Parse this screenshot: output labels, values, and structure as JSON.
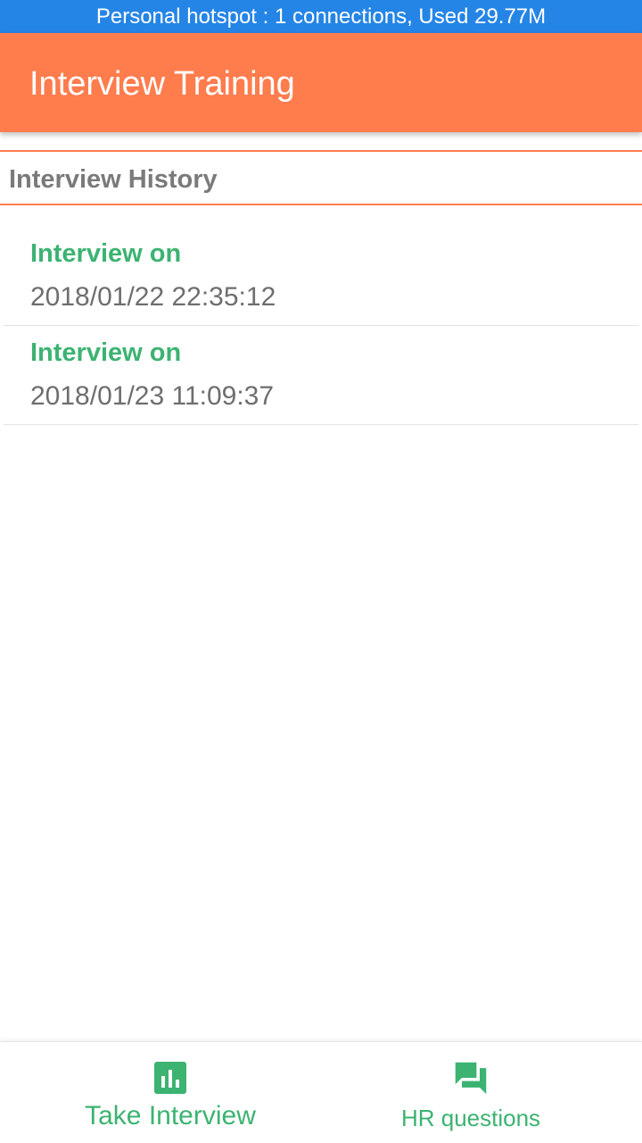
{
  "status_bar": {
    "text": "Personal hotspot : 1 connections, Used 29.77M"
  },
  "app_bar": {
    "title": "Interview Training"
  },
  "section": {
    "title": "Interview History"
  },
  "history": [
    {
      "label": "Interview on",
      "datetime": "2018/01/22 22:35:12"
    },
    {
      "label": "Interview on",
      "datetime": "2018/01/23 11:09:37"
    }
  ],
  "bottom_nav": {
    "items": [
      {
        "label": "Take Interview",
        "icon": "bar-chart-icon"
      },
      {
        "label": "HR questions",
        "icon": "forum-icon"
      }
    ]
  },
  "colors": {
    "status_bar": "#2585e6",
    "app_bar": "#ff7c4d",
    "accent_green": "#3cb371",
    "section_text": "#7a7a7a"
  }
}
